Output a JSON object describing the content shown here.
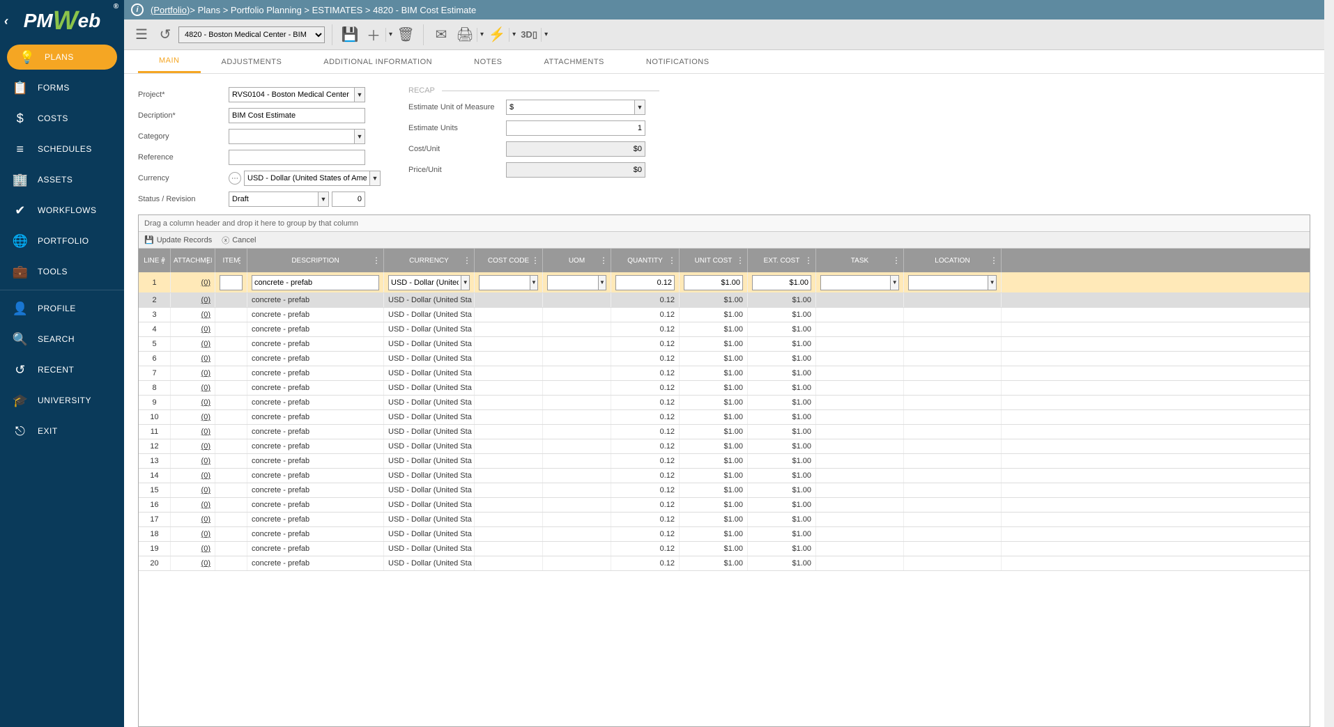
{
  "breadcrumb": {
    "portfolio": "(Portfolio)",
    "rest": " > Plans > Portfolio Planning > ESTIMATES > 4820 - BIM Cost Estimate"
  },
  "toolbar": {
    "record_selector": "4820 - Boston Medical Center - BIM"
  },
  "sidebar": {
    "items": [
      {
        "label": "PLANS",
        "icon": "💡"
      },
      {
        "label": "FORMS",
        "icon": "📋"
      },
      {
        "label": "COSTS",
        "icon": "$"
      },
      {
        "label": "SCHEDULES",
        "icon": "≡"
      },
      {
        "label": "ASSETS",
        "icon": "🏢"
      },
      {
        "label": "WORKFLOWS",
        "icon": "✔"
      },
      {
        "label": "PORTFOLIO",
        "icon": "🌐"
      },
      {
        "label": "TOOLS",
        "icon": "💼"
      },
      {
        "label": "PROFILE",
        "icon": "👤"
      },
      {
        "label": "SEARCH",
        "icon": "🔍"
      },
      {
        "label": "RECENT",
        "icon": "↺"
      },
      {
        "label": "UNIVERSITY",
        "icon": "🎓"
      },
      {
        "label": "EXIT",
        "icon": "⎋"
      }
    ]
  },
  "tabs": {
    "items": [
      "MAIN",
      "ADJUSTMENTS",
      "ADDITIONAL INFORMATION",
      "NOTES",
      "ATTACHMENTS",
      "NOTIFICATIONS"
    ]
  },
  "form": {
    "labels": {
      "project": "Project*",
      "description": "Decription*",
      "category": "Category",
      "reference": "Reference",
      "currency": "Currency",
      "status": "Status / Revision",
      "recap": "RECAP",
      "eum": "Estimate Unit of Measure",
      "eunits": "Estimate Units",
      "cost_unit": "Cost/Unit",
      "price_unit": "Price/Unit"
    },
    "values": {
      "project": "RVS0104 - Boston Medical Center",
      "description": "BIM Cost Estimate",
      "category": "",
      "reference": "",
      "currency": "USD - Dollar (United States of America)",
      "status": "Draft",
      "revision": "0",
      "eum": "$",
      "eunits": "1",
      "cost_unit": "$0",
      "price_unit": "$0"
    }
  },
  "grid": {
    "group_hint": "Drag a column header and drop it here to group by that column",
    "update_label": "Update Records",
    "cancel_label": "Cancel",
    "headers": {
      "line": "LINE #",
      "attach": "ATTACHMENTS",
      "item": "ITEM",
      "desc": "DESCRIPTION",
      "curr": "CURRENCY",
      "cost": "COST CODE",
      "uom": "UOM",
      "qty": "QUANTITY",
      "unit": "UNIT COST",
      "ext": "EXT. COST",
      "task": "TASK",
      "loc": "LOCATION"
    },
    "edit_row": {
      "line": "1",
      "attach": "(0)",
      "item": "",
      "desc": "concrete - prefab",
      "curr": "USD - Dollar (United",
      "cost": "",
      "uom": "",
      "qty": "0.12",
      "unit": "$1.00",
      "ext": "$1.00",
      "task": "",
      "loc": ""
    },
    "rows": [
      {
        "line": "2",
        "attach": "(0)",
        "desc": "concrete - prefab",
        "curr": "USD - Dollar (United States of America)",
        "qty": "0.12",
        "unit": "$1.00",
        "ext": "$1.00",
        "sel": true
      },
      {
        "line": "3",
        "attach": "(0)",
        "desc": "concrete - prefab",
        "curr": "USD - Dollar (United States of America)",
        "qty": "0.12",
        "unit": "$1.00",
        "ext": "$1.00"
      },
      {
        "line": "4",
        "attach": "(0)",
        "desc": "concrete - prefab",
        "curr": "USD - Dollar (United States of America)",
        "qty": "0.12",
        "unit": "$1.00",
        "ext": "$1.00"
      },
      {
        "line": "5",
        "attach": "(0)",
        "desc": "concrete - prefab",
        "curr": "USD - Dollar (United States of America)",
        "qty": "0.12",
        "unit": "$1.00",
        "ext": "$1.00"
      },
      {
        "line": "6",
        "attach": "(0)",
        "desc": "concrete - prefab",
        "curr": "USD - Dollar (United States of America)",
        "qty": "0.12",
        "unit": "$1.00",
        "ext": "$1.00"
      },
      {
        "line": "7",
        "attach": "(0)",
        "desc": "concrete - prefab",
        "curr": "USD - Dollar (United States of America)",
        "qty": "0.12",
        "unit": "$1.00",
        "ext": "$1.00"
      },
      {
        "line": "8",
        "attach": "(0)",
        "desc": "concrete - prefab",
        "curr": "USD - Dollar (United States of America)",
        "qty": "0.12",
        "unit": "$1.00",
        "ext": "$1.00"
      },
      {
        "line": "9",
        "attach": "(0)",
        "desc": "concrete - prefab",
        "curr": "USD - Dollar (United States of America)",
        "qty": "0.12",
        "unit": "$1.00",
        "ext": "$1.00"
      },
      {
        "line": "10",
        "attach": "(0)",
        "desc": "concrete - prefab",
        "curr": "USD - Dollar (United States of America)",
        "qty": "0.12",
        "unit": "$1.00",
        "ext": "$1.00"
      },
      {
        "line": "11",
        "attach": "(0)",
        "desc": "concrete - prefab",
        "curr": "USD - Dollar (United States of America)",
        "qty": "0.12",
        "unit": "$1.00",
        "ext": "$1.00"
      },
      {
        "line": "12",
        "attach": "(0)",
        "desc": "concrete - prefab",
        "curr": "USD - Dollar (United States of America)",
        "qty": "0.12",
        "unit": "$1.00",
        "ext": "$1.00"
      },
      {
        "line": "13",
        "attach": "(0)",
        "desc": "concrete - prefab",
        "curr": "USD - Dollar (United States of America)",
        "qty": "0.12",
        "unit": "$1.00",
        "ext": "$1.00"
      },
      {
        "line": "14",
        "attach": "(0)",
        "desc": "concrete - prefab",
        "curr": "USD - Dollar (United States of America)",
        "qty": "0.12",
        "unit": "$1.00",
        "ext": "$1.00"
      },
      {
        "line": "15",
        "attach": "(0)",
        "desc": "concrete - prefab",
        "curr": "USD - Dollar (United States of America)",
        "qty": "0.12",
        "unit": "$1.00",
        "ext": "$1.00"
      },
      {
        "line": "16",
        "attach": "(0)",
        "desc": "concrete - prefab",
        "curr": "USD - Dollar (United States of America)",
        "qty": "0.12",
        "unit": "$1.00",
        "ext": "$1.00"
      },
      {
        "line": "17",
        "attach": "(0)",
        "desc": "concrete - prefab",
        "curr": "USD - Dollar (United States of America)",
        "qty": "0.12",
        "unit": "$1.00",
        "ext": "$1.00"
      },
      {
        "line": "18",
        "attach": "(0)",
        "desc": "concrete - prefab",
        "curr": "USD - Dollar (United States of America)",
        "qty": "0.12",
        "unit": "$1.00",
        "ext": "$1.00"
      },
      {
        "line": "19",
        "attach": "(0)",
        "desc": "concrete - prefab",
        "curr": "USD - Dollar (United States of America)",
        "qty": "0.12",
        "unit": "$1.00",
        "ext": "$1.00"
      },
      {
        "line": "20",
        "attach": "(0)",
        "desc": "concrete - prefab",
        "curr": "USD - Dollar (United States of America)",
        "qty": "0.12",
        "unit": "$1.00",
        "ext": "$1.00"
      }
    ]
  }
}
